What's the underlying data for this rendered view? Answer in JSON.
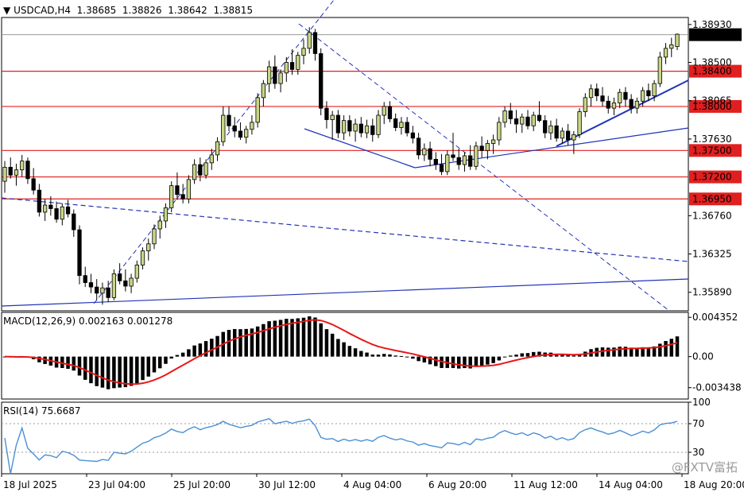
{
  "header": {
    "symbol": "USDCAD,H4",
    "open": "1.38685",
    "high": "1.38826",
    "low": "1.38642",
    "close": "1.38815",
    "macd_label": "MACD(12,26,9) 0.002163 0.001278",
    "rsi_label": "RSI(14) 75.6687"
  },
  "watermark": "@FXTV富拓",
  "colors": {
    "bull_body": "#c8d787",
    "bear_body": "#000000",
    "level_line": "#e02020",
    "trend_line": "#2033b8",
    "macd_signal": "#e81818",
    "rsi_line": "#4a8fd6"
  },
  "chart_data": [
    {
      "type": "candlestick",
      "price_axis_ticks": [
        "1.38930",
        "1.38500",
        "1.38065",
        "1.37630",
        "1.36760",
        "1.36325",
        "1.35890"
      ],
      "ylim": [
        1.3568,
        1.3901
      ],
      "last_price": "1.38815",
      "horizontal_levels": [
        "1.38400",
        "1.38000",
        "1.37500",
        "1.37200",
        "1.36950"
      ],
      "time_labels": [
        "18 Jul 2025",
        "23 Jul 04:00",
        "25 Jul 20:00",
        "30 Jul 12:00",
        "4 Aug 04:00",
        "6 Aug 20:00",
        "11 Aug 12:00",
        "14 Aug 04:00",
        "18 Aug 20:00"
      ],
      "ohlc": [
        [
          1.3715,
          1.3738,
          1.3702,
          1.3731
        ],
        [
          1.3731,
          1.3742,
          1.3718,
          1.3722
        ],
        [
          1.3722,
          1.3735,
          1.371,
          1.3728
        ],
        [
          1.3728,
          1.3745,
          1.372,
          1.3738
        ],
        [
          1.3738,
          1.3742,
          1.3712,
          1.3718
        ],
        [
          1.3718,
          1.373,
          1.37,
          1.3705
        ],
        [
          1.3705,
          1.3712,
          1.3675,
          1.368
        ],
        [
          1.368,
          1.3695,
          1.367,
          1.3688
        ],
        [
          1.3688,
          1.3698,
          1.3676,
          1.3684
        ],
        [
          1.3684,
          1.3692,
          1.3668,
          1.3672
        ],
        [
          1.3672,
          1.369,
          1.3665,
          1.3686
        ],
        [
          1.3686,
          1.3694,
          1.3674,
          1.3678
        ],
        [
          1.3678,
          1.3683,
          1.3652,
          1.366
        ],
        [
          1.366,
          1.3665,
          1.3598,
          1.3608
        ],
        [
          1.3608,
          1.3618,
          1.3595,
          1.36
        ],
        [
          1.36,
          1.361,
          1.3588,
          1.3595
        ],
        [
          1.3595,
          1.3604,
          1.358,
          1.3588
        ],
        [
          1.3588,
          1.36,
          1.3575,
          1.3594
        ],
        [
          1.3594,
          1.3602,
          1.3578,
          1.3583
        ],
        [
          1.3583,
          1.3615,
          1.358,
          1.361
        ],
        [
          1.361,
          1.3622,
          1.3598,
          1.3602
        ],
        [
          1.3602,
          1.3615,
          1.359,
          1.3596
        ],
        [
          1.3596,
          1.361,
          1.3588,
          1.3605
        ],
        [
          1.3605,
          1.3625,
          1.36,
          1.362
        ],
        [
          1.362,
          1.364,
          1.3615,
          1.3636
        ],
        [
          1.3636,
          1.365,
          1.3625,
          1.3644
        ],
        [
          1.3644,
          1.3666,
          1.3638,
          1.3661
        ],
        [
          1.3661,
          1.3676,
          1.365,
          1.367
        ],
        [
          1.367,
          1.369,
          1.3662,
          1.3685
        ],
        [
          1.3685,
          1.3715,
          1.368,
          1.371
        ],
        [
          1.371,
          1.3725,
          1.3694,
          1.37
        ],
        [
          1.37,
          1.3712,
          1.369,
          1.3695
        ],
        [
          1.3695,
          1.3722,
          1.369,
          1.3717
        ],
        [
          1.3717,
          1.374,
          1.3712,
          1.3734
        ],
        [
          1.3734,
          1.3742,
          1.3715,
          1.3722
        ],
        [
          1.3722,
          1.374,
          1.3718,
          1.3736
        ],
        [
          1.3736,
          1.3752,
          1.3728,
          1.3745
        ],
        [
          1.3745,
          1.3765,
          1.3738,
          1.376
        ],
        [
          1.376,
          1.38,
          1.3755,
          1.379
        ],
        [
          1.379,
          1.38,
          1.3772,
          1.3778
        ],
        [
          1.3778,
          1.3788,
          1.3765,
          1.3772
        ],
        [
          1.3772,
          1.3782,
          1.3762,
          1.3765
        ],
        [
          1.3765,
          1.3778,
          1.3758,
          1.3774
        ],
        [
          1.3774,
          1.379,
          1.3768,
          1.3782
        ],
        [
          1.3782,
          1.3815,
          1.3776,
          1.381
        ],
        [
          1.381,
          1.383,
          1.38,
          1.3826
        ],
        [
          1.3826,
          1.3852,
          1.3816,
          1.3845
        ],
        [
          1.3845,
          1.3858,
          1.382,
          1.3826
        ],
        [
          1.3826,
          1.3842,
          1.3816,
          1.3838
        ],
        [
          1.3838,
          1.3856,
          1.3828,
          1.385
        ],
        [
          1.385,
          1.3865,
          1.3836,
          1.3842
        ],
        [
          1.3842,
          1.3862,
          1.3836,
          1.3858
        ],
        [
          1.3858,
          1.3876,
          1.3848,
          1.3866
        ],
        [
          1.3866,
          1.389,
          1.386,
          1.3884
        ],
        [
          1.3884,
          1.3888,
          1.3852,
          1.386
        ],
        [
          1.386,
          1.3866,
          1.379,
          1.3798
        ],
        [
          1.3798,
          1.3806,
          1.3775,
          1.3785
        ],
        [
          1.3785,
          1.3795,
          1.3762,
          1.379
        ],
        [
          1.379,
          1.3796,
          1.3764,
          1.377
        ],
        [
          1.377,
          1.379,
          1.3762,
          1.3784
        ],
        [
          1.3784,
          1.379,
          1.3766,
          1.3772
        ],
        [
          1.3772,
          1.3786,
          1.376,
          1.378
        ],
        [
          1.378,
          1.3788,
          1.3765,
          1.377
        ],
        [
          1.377,
          1.3785,
          1.3764,
          1.3778
        ],
        [
          1.3778,
          1.3786,
          1.376,
          1.3768
        ],
        [
          1.3768,
          1.3796,
          1.3764,
          1.379
        ],
        [
          1.379,
          1.3805,
          1.378,
          1.38
        ],
        [
          1.38,
          1.3806,
          1.3782,
          1.3786
        ],
        [
          1.3786,
          1.3792,
          1.3772,
          1.3776
        ],
        [
          1.3776,
          1.3788,
          1.3768,
          1.3782
        ],
        [
          1.3782,
          1.3788,
          1.3766,
          1.377
        ],
        [
          1.377,
          1.3778,
          1.3758,
          1.3764
        ],
        [
          1.3764,
          1.377,
          1.374,
          1.3745
        ],
        [
          1.3745,
          1.3758,
          1.3738,
          1.3752
        ],
        [
          1.3752,
          1.376,
          1.3732,
          1.374
        ],
        [
          1.374,
          1.3748,
          1.3728,
          1.3734
        ],
        [
          1.3734,
          1.3746,
          1.3722,
          1.3726
        ],
        [
          1.3726,
          1.375,
          1.3722,
          1.3745
        ],
        [
          1.3745,
          1.377,
          1.3738,
          1.3742
        ],
        [
          1.3742,
          1.3752,
          1.3728,
          1.3734
        ],
        [
          1.3734,
          1.3748,
          1.3726,
          1.3744
        ],
        [
          1.3744,
          1.3756,
          1.3728,
          1.3732
        ],
        [
          1.3732,
          1.376,
          1.3728,
          1.3755
        ],
        [
          1.3755,
          1.3766,
          1.3742,
          1.375
        ],
        [
          1.375,
          1.3762,
          1.374,
          1.3758
        ],
        [
          1.3758,
          1.3768,
          1.3746,
          1.3762
        ],
        [
          1.3762,
          1.3788,
          1.3756,
          1.3782
        ],
        [
          1.3782,
          1.38,
          1.3776,
          1.3795
        ],
        [
          1.3795,
          1.3804,
          1.378,
          1.3786
        ],
        [
          1.3786,
          1.3796,
          1.377,
          1.378
        ],
        [
          1.378,
          1.3792,
          1.377,
          1.3788
        ],
        [
          1.3788,
          1.3796,
          1.3774,
          1.3778
        ],
        [
          1.3778,
          1.3794,
          1.3772,
          1.379
        ],
        [
          1.379,
          1.3806,
          1.3782,
          1.3784
        ],
        [
          1.3784,
          1.379,
          1.3764,
          1.377
        ],
        [
          1.377,
          1.3784,
          1.3762,
          1.3778
        ],
        [
          1.3778,
          1.3786,
          1.376,
          1.3764
        ],
        [
          1.3764,
          1.3776,
          1.3758,
          1.3772
        ],
        [
          1.3772,
          1.378,
          1.3756,
          1.3762
        ],
        [
          1.3762,
          1.3772,
          1.3746,
          1.3768
        ],
        [
          1.3768,
          1.3798,
          1.3764,
          1.3794
        ],
        [
          1.3794,
          1.3815,
          1.3788,
          1.381
        ],
        [
          1.381,
          1.3825,
          1.38,
          1.382
        ],
        [
          1.382,
          1.3826,
          1.3806,
          1.3812
        ],
        [
          1.3812,
          1.3822,
          1.38,
          1.3806
        ],
        [
          1.3806,
          1.3812,
          1.3792,
          1.3798
        ],
        [
          1.3798,
          1.381,
          1.379,
          1.3804
        ],
        [
          1.3804,
          1.382,
          1.3798,
          1.3816
        ],
        [
          1.3816,
          1.3822,
          1.38,
          1.3808
        ],
        [
          1.3808,
          1.3814,
          1.3792,
          1.3798
        ],
        [
          1.3798,
          1.381,
          1.3792,
          1.3806
        ],
        [
          1.3806,
          1.3822,
          1.38,
          1.3818
        ],
        [
          1.3818,
          1.3826,
          1.3806,
          1.3812
        ],
        [
          1.3812,
          1.383,
          1.3806,
          1.3826
        ],
        [
          1.3826,
          1.3862,
          1.3822,
          1.3856
        ],
        [
          1.3856,
          1.3872,
          1.3848,
          1.3866
        ],
        [
          1.3866,
          1.3878,
          1.3856,
          1.387
        ],
        [
          1.3868,
          1.3883,
          1.3864,
          1.3882
        ]
      ]
    },
    {
      "type": "bar",
      "name": "MACD(12,26,9)",
      "macd_value": "0.002163",
      "signal_value": "0.001278",
      "axis_ticks": [
        "0.004352",
        "0.00",
        "-0.003438"
      ],
      "ylim": [
        -0.0047,
        0.0049
      ]
    },
    {
      "type": "line",
      "name": "RSI(14)",
      "rsi_value": "75.6687",
      "axis_ticks": [
        "100",
        "70",
        "30"
      ],
      "levels": [
        70,
        30
      ],
      "ylim": [
        0,
        100
      ]
    }
  ]
}
